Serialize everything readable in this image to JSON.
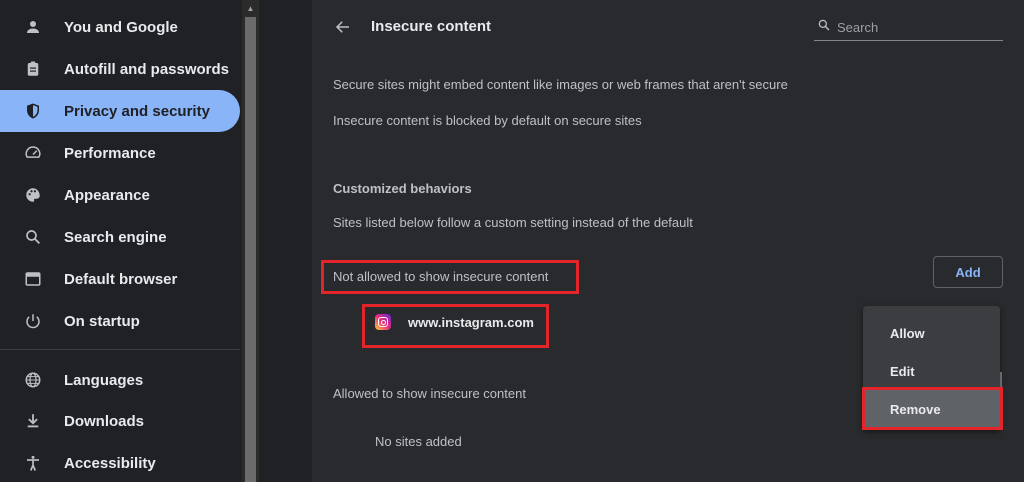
{
  "sidebar": {
    "items": [
      {
        "label": "You and Google",
        "icon": "person-icon"
      },
      {
        "label": "Autofill and passwords",
        "icon": "clipboard-icon"
      },
      {
        "label": "Privacy and security",
        "icon": "shield-icon",
        "active": true
      },
      {
        "label": "Performance",
        "icon": "speedometer-icon"
      },
      {
        "label": "Appearance",
        "icon": "palette-icon"
      },
      {
        "label": "Search engine",
        "icon": "search-icon"
      },
      {
        "label": "Default browser",
        "icon": "browser-icon"
      },
      {
        "label": "On startup",
        "icon": "power-icon"
      },
      {
        "label": "Languages",
        "icon": "globe-icon"
      },
      {
        "label": "Downloads",
        "icon": "download-icon"
      },
      {
        "label": "Accessibility",
        "icon": "accessibility-icon"
      }
    ]
  },
  "header": {
    "title": "Insecure content",
    "search_placeholder": "Search"
  },
  "main": {
    "description_1": "Secure sites might embed content like images or web frames that aren't secure",
    "description_2": "Insecure content is blocked by default on secure sites",
    "customized_heading": "Customized behaviors",
    "customized_description": "Sites listed below follow a custom setting instead of the default",
    "not_allowed_heading": "Not allowed to show insecure content",
    "add_label": "Add",
    "not_allowed_sites": [
      {
        "name": "www.instagram.com",
        "icon": "instagram-icon"
      }
    ],
    "allowed_heading": "Allowed to show insecure content",
    "no_sites_label": "No sites added"
  },
  "context_menu": {
    "items": [
      {
        "label": "Allow"
      },
      {
        "label": "Edit"
      },
      {
        "label": "Remove",
        "hovered": true
      }
    ]
  },
  "colors": {
    "accent": "#8ab4f8",
    "highlight": "#e3242b",
    "background": "#202124",
    "card": "#292a2d"
  }
}
